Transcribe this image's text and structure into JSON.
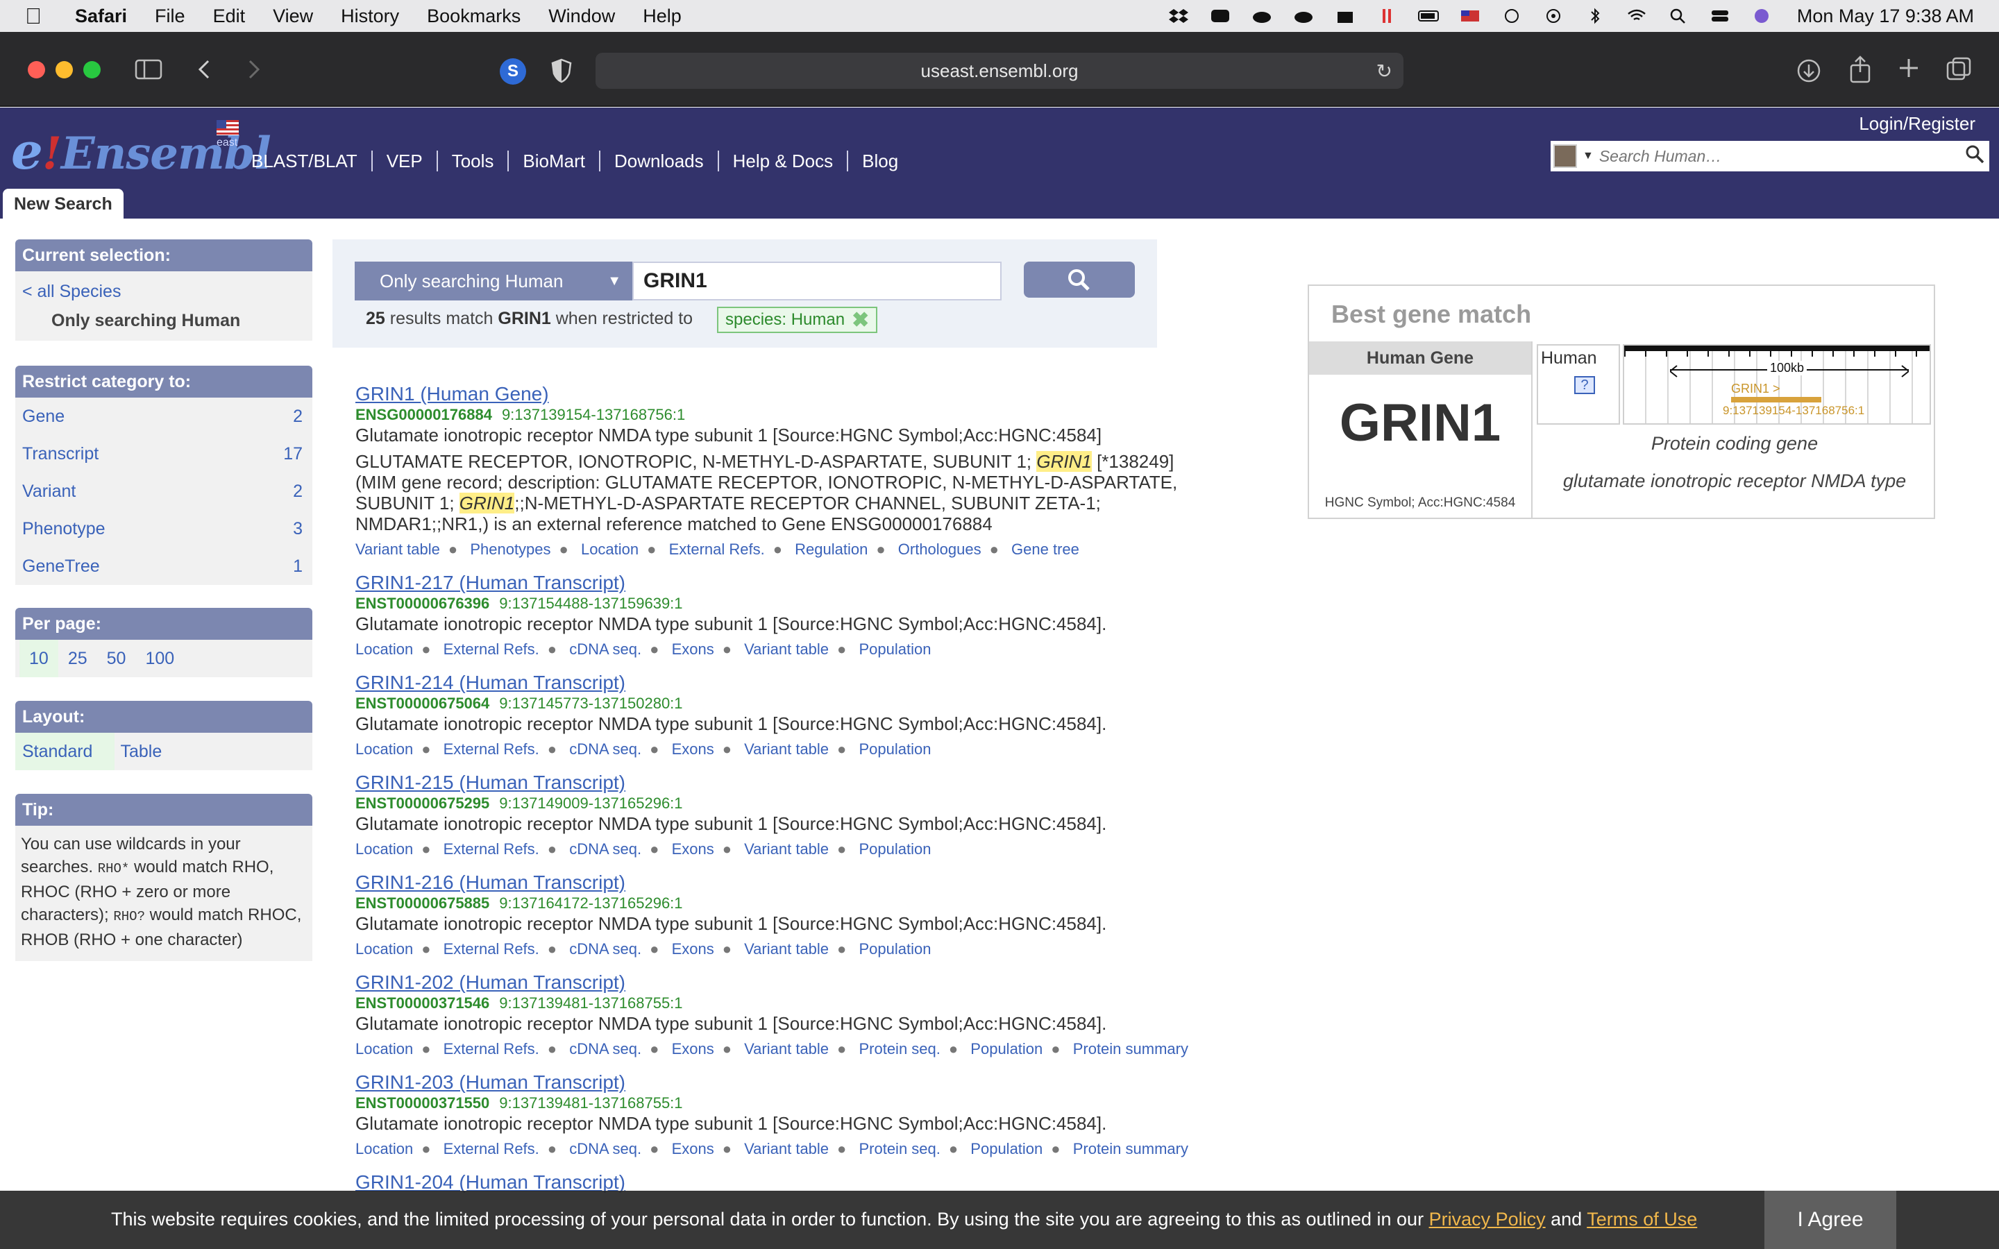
{
  "menubar": {
    "app": "Safari",
    "items": [
      "File",
      "Edit",
      "View",
      "History",
      "Bookmarks",
      "Window",
      "Help"
    ],
    "clock": "Mon May 17  9:38 AM"
  },
  "browser": {
    "url": "useast.ensembl.org",
    "extension_letter": "S"
  },
  "header": {
    "logo_e": "e",
    "logo_bang": "!",
    "logo_text": "Ensembl",
    "site_region": "east",
    "login": "Login/Register",
    "nav": [
      "BLAST/BLAT",
      "VEP",
      "Tools",
      "BioMart",
      "Downloads",
      "Help & Docs",
      "Blog"
    ],
    "search_placeholder": "Search Human…",
    "tab": "New Search"
  },
  "sidebar": {
    "current_selection": {
      "title": "Current selection:",
      "all_species": "< all Species",
      "active": "Only searching Human"
    },
    "restrict": {
      "title": "Restrict category to:",
      "items": [
        {
          "label": "Gene",
          "count": "2"
        },
        {
          "label": "Transcript",
          "count": "17"
        },
        {
          "label": "Variant",
          "count": "2"
        },
        {
          "label": "Phenotype",
          "count": "3"
        },
        {
          "label": "GeneTree",
          "count": "1"
        }
      ]
    },
    "per_page": {
      "title": "Per page:",
      "options": [
        "10",
        "25",
        "50",
        "100"
      ]
    },
    "layout": {
      "title": "Layout:",
      "options": [
        "Standard",
        "Table"
      ]
    },
    "tip": {
      "title": "Tip:",
      "t1": "You can use wildcards in your searches. ",
      "c1": "RHO*",
      "t2": " would match RHO, RHOC (RHO + zero or more characters); ",
      "c2": "RHO?",
      "t3": " would match RHOC, RHOB (RHO + one character)"
    }
  },
  "search": {
    "species_select": "Only searching Human",
    "query": "GRIN1",
    "count": "25",
    "count_mid": "results match",
    "count_term": "GRIN1",
    "count_tail": "when restricted to",
    "tag": "species: Human"
  },
  "results": [
    {
      "title": "GRIN1 (Human Gene)",
      "stable_id": "ENSG00000176884",
      "location": "9:137139154-137168756:1",
      "desc": "Glutamate ionotropic receptor NMDA type subunit 1 [Source:HGNC Symbol;Acc:HGNC:4584]",
      "long_a": "GLUTAMATE RECEPTOR, IONOTROPIC, N-METHYL-D-ASPARTATE, SUBUNIT 1; ",
      "long_hl1": "GRIN1",
      "long_b": " [*138249] (MIM gene record; description: GLUTAMATE RECEPTOR, IONOTROPIC, N-METHYL-D-ASPARTATE, SUBUNIT 1; ",
      "long_hl2": "GRIN1",
      "long_c": ";;N-METHYL-D-ASPARTATE RECEPTOR CHANNEL, SUBUNIT ZETA-1; NMDAR1;;NR1,) is an external reference matched to Gene ENSG00000176884",
      "links": [
        "Variant table",
        "Phenotypes",
        "Location",
        "External Refs.",
        "Regulation",
        "Orthologues",
        "Gene tree"
      ]
    },
    {
      "title": "GRIN1-217 (Human Transcript)",
      "stable_id": "ENST00000676396",
      "location": "9:137154488-137159639:1",
      "desc": "Glutamate ionotropic receptor NMDA type subunit 1 [Source:HGNC Symbol;Acc:HGNC:4584].",
      "links": [
        "Location",
        "External Refs.",
        "cDNA seq.",
        "Exons",
        "Variant table",
        "Population"
      ]
    },
    {
      "title": "GRIN1-214 (Human Transcript)",
      "stable_id": "ENST00000675064",
      "location": "9:137145773-137150280:1",
      "desc": "Glutamate ionotropic receptor NMDA type subunit 1 [Source:HGNC Symbol;Acc:HGNC:4584].",
      "links": [
        "Location",
        "External Refs.",
        "cDNA seq.",
        "Exons",
        "Variant table",
        "Population"
      ]
    },
    {
      "title": "GRIN1-215 (Human Transcript)",
      "stable_id": "ENST00000675295",
      "location": "9:137149009-137165296:1",
      "desc": "Glutamate ionotropic receptor NMDA type subunit 1 [Source:HGNC Symbol;Acc:HGNC:4584].",
      "links": [
        "Location",
        "External Refs.",
        "cDNA seq.",
        "Exons",
        "Variant table",
        "Population"
      ]
    },
    {
      "title": "GRIN1-216 (Human Transcript)",
      "stable_id": "ENST00000675885",
      "location": "9:137164172-137165296:1",
      "desc": "Glutamate ionotropic receptor NMDA type subunit 1 [Source:HGNC Symbol;Acc:HGNC:4584].",
      "links": [
        "Location",
        "External Refs.",
        "cDNA seq.",
        "Exons",
        "Variant table",
        "Population"
      ]
    },
    {
      "title": "GRIN1-202 (Human Transcript)",
      "stable_id": "ENST00000371546",
      "location": "9:137139481-137168755:1",
      "desc": "Glutamate ionotropic receptor NMDA type subunit 1 [Source:HGNC Symbol;Acc:HGNC:4584].",
      "links": [
        "Location",
        "External Refs.",
        "cDNA seq.",
        "Exons",
        "Variant table",
        "Protein seq.",
        "Population",
        "Protein summary"
      ]
    },
    {
      "title": "GRIN1-203 (Human Transcript)",
      "stable_id": "ENST00000371550",
      "location": "9:137139481-137168755:1",
      "desc": "Glutamate ionotropic receptor NMDA type subunit 1 [Source:HGNC Symbol;Acc:HGNC:4584].",
      "links": [
        "Location",
        "External Refs.",
        "cDNA seq.",
        "Exons",
        "Variant table",
        "Protein seq.",
        "Population",
        "Protein summary"
      ]
    },
    {
      "title": "GRIN1-204 (Human Transcript)"
    }
  ],
  "best_match": {
    "title": "Best gene match",
    "species_gene": "Human Gene",
    "symbol": "GRIN1",
    "acc": "HGNC Symbol; Acc:HGNC:4584",
    "species": "Human",
    "help": "?",
    "scale": "100kb",
    "gene_label": "GRIN1 >",
    "gene_loc": "9:137139154-137168756:1",
    "biotype": "Protein coding gene",
    "description": "glutamate ionotropic receptor NMDA type"
  },
  "cookie": {
    "text": "This website requires cookies, and the limited processing of your personal data in order to function. By using the site you are agreeing to this as outlined in our ",
    "privacy": "Privacy Policy",
    "and": " and ",
    "terms": "Terms of Use",
    "agree": "I Agree"
  }
}
